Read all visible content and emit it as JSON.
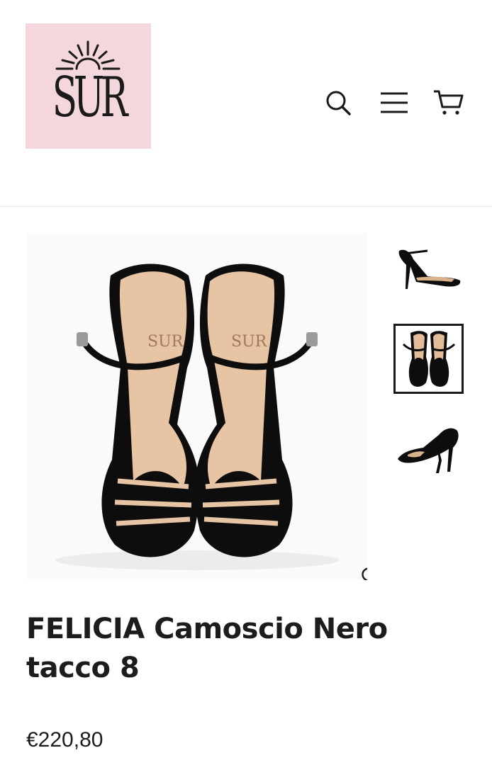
{
  "brand": {
    "logo_text": "SUR"
  },
  "header": {
    "icons": [
      "search-icon",
      "menu-icon",
      "cart-icon"
    ]
  },
  "gallery": {
    "selected_thumbnail": 2,
    "thumbnails": [
      {
        "name": "side-view"
      },
      {
        "name": "top-view"
      },
      {
        "name": "back-view"
      }
    ]
  },
  "product": {
    "title": "FELICIA Camoscio Nero tacco 8",
    "price": "€220,80"
  },
  "colors": {
    "logo_bg": "#f3d7dc",
    "text": "#1c1c1c"
  }
}
